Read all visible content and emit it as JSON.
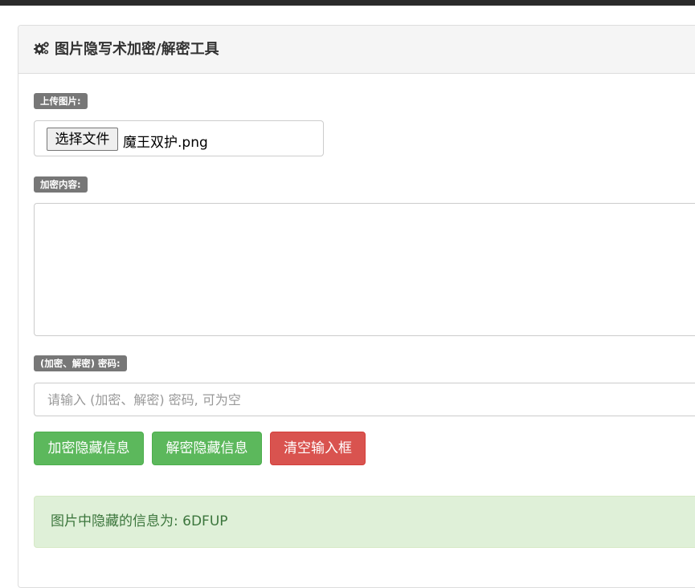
{
  "panel": {
    "title": "图片隐写术加密/解密工具",
    "title_icon": "gears-icon"
  },
  "upload": {
    "label": "上传图片:",
    "choose_button": "选择文件",
    "file_name": "魔王双护.png"
  },
  "content": {
    "label": "加密内容:",
    "value": ""
  },
  "password": {
    "label": "(加密、解密) 密码:",
    "placeholder": "请输入 (加密、解密) 密码, 可为空",
    "value": ""
  },
  "buttons": {
    "encrypt": "加密隐藏信息",
    "decrypt": "解密隐藏信息",
    "clear": "清空输入框"
  },
  "result": {
    "text": "图片中隐藏的信息为: 6DFUP"
  },
  "colors": {
    "success": "#5cb85c",
    "danger": "#d9534f",
    "label_bg": "#777777",
    "alert_bg": "#dff0d8",
    "alert_text": "#3c763d"
  }
}
